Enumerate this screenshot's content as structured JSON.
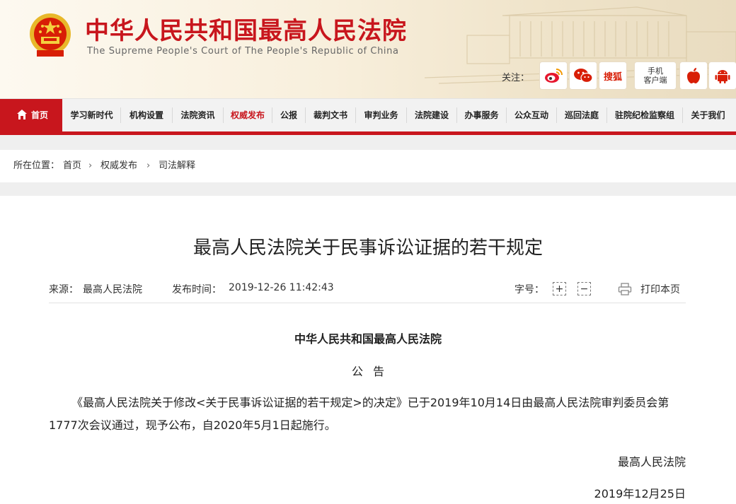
{
  "header": {
    "site_title": "中华人民共和国最高人民法院",
    "site_subtitle": "The Supreme People's Court of The People's Republic of China",
    "follow_label": "关注：",
    "social": [
      {
        "name": "weibo-icon",
        "color": "#e6162d"
      },
      {
        "name": "wechat-icon",
        "color": "#d81e06"
      },
      {
        "name": "sohu",
        "label": "搜狐",
        "color": "#d81e06"
      }
    ],
    "mobile_client": [
      "手机",
      "客户端"
    ],
    "apps": [
      {
        "name": "apple-icon",
        "color": "#d81e06"
      },
      {
        "name": "android-icon",
        "color": "#d81e06"
      }
    ]
  },
  "nav": {
    "home": "首页",
    "items": [
      "学习新时代",
      "机构设置",
      "法院资讯",
      "权威发布",
      "公报",
      "裁判文书",
      "审判业务",
      "法院建设",
      "办事服务",
      "公众互动",
      "巡回法庭",
      "驻院纪检监察组",
      "关于我们"
    ],
    "active_index": 3
  },
  "breadcrumb": {
    "prefix": "所在位置：",
    "items": [
      "首页",
      "权威发布",
      "司法解释"
    ]
  },
  "article": {
    "title": "最高人民法院关于民事诉讼证据的若干规定",
    "source_label": "来源：",
    "source": "最高人民法院",
    "time_label": "发布时间：",
    "time": "2019-12-26 11:42:43",
    "font_size_label": "字号：",
    "font_plus": "+",
    "font_minus": "−",
    "print_label": "打印本页",
    "org_heading": "中华人民共和国最高人民法院",
    "notice": "公告",
    "paragraph": "《最高人民法院关于修改<关于民事诉讼证据的若干规定>的决定》已于2019年10月14日由最高人民法院审判委员会第1777次会议通过，现予公布，自2020年5月1日起施行。",
    "signature": "最高人民法院",
    "date": "2019年12月25日"
  },
  "colors": {
    "brand_red": "#c8161d",
    "nav_bg": "#f2f2f2"
  }
}
